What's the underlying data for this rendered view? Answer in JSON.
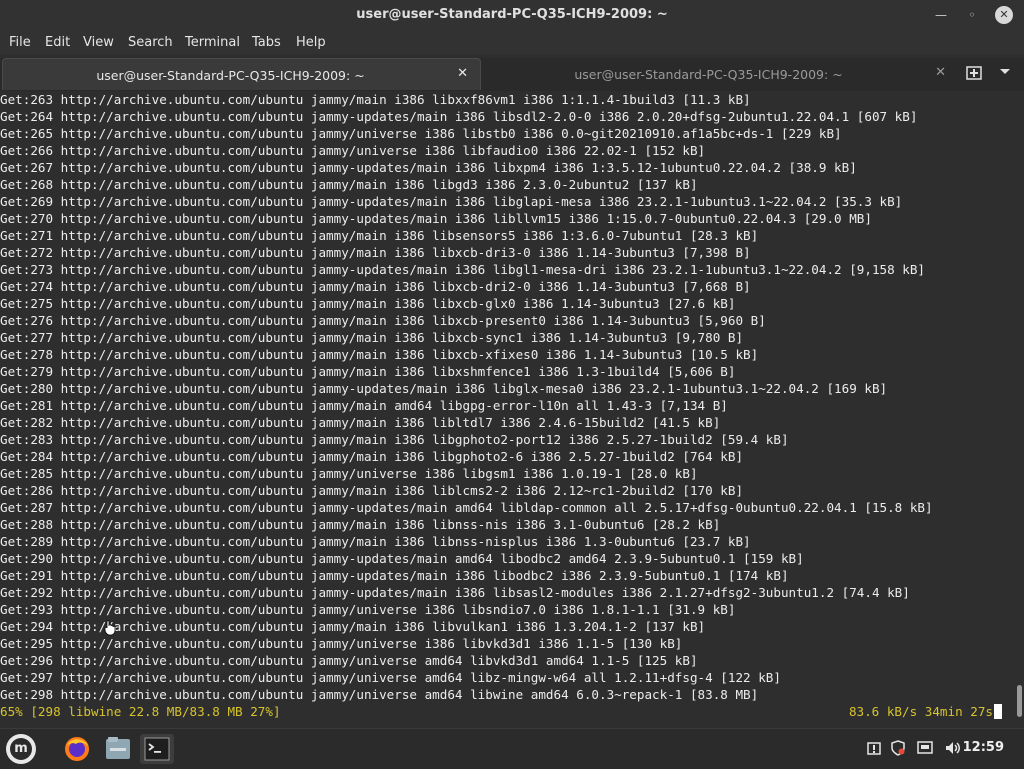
{
  "window": {
    "title": "user@user-Standard-PC-Q35-ICH9-2009: ~",
    "controls": {
      "minimize": "minimize-icon",
      "maximize": "maximize-icon",
      "close": "close-icon"
    }
  },
  "menu": [
    "File",
    "Edit",
    "View",
    "Search",
    "Terminal",
    "Tabs",
    "Help"
  ],
  "tabs": [
    {
      "label": "user@user-Standard-PC-Q35-ICH9-2009: ~",
      "active": true
    },
    {
      "label": "user@user-Standard-PC-Q35-ICH9-2009: ~",
      "active": false
    }
  ],
  "tab_close_symbol": "✕",
  "terminal": {
    "lines": [
      "Get:263 http://archive.ubuntu.com/ubuntu jammy/main i386 libxxf86vm1 i386 1:1.1.4-1build3 [11.3 kB]",
      "Get:264 http://archive.ubuntu.com/ubuntu jammy-updates/main i386 libsdl2-2.0-0 i386 2.0.20+dfsg-2ubuntu1.22.04.1 [607 kB]",
      "Get:265 http://archive.ubuntu.com/ubuntu jammy/universe i386 libstb0 i386 0.0~git20210910.af1a5bc+ds-1 [229 kB]",
      "Get:266 http://archive.ubuntu.com/ubuntu jammy/universe i386 libfaudio0 i386 22.02-1 [152 kB]",
      "Get:267 http://archive.ubuntu.com/ubuntu jammy-updates/main i386 libxpm4 i386 1:3.5.12-1ubuntu0.22.04.2 [38.9 kB]",
      "Get:268 http://archive.ubuntu.com/ubuntu jammy/main i386 libgd3 i386 2.3.0-2ubuntu2 [137 kB]",
      "Get:269 http://archive.ubuntu.com/ubuntu jammy-updates/main i386 libglapi-mesa i386 23.2.1-1ubuntu3.1~22.04.2 [35.3 kB]",
      "Get:270 http://archive.ubuntu.com/ubuntu jammy-updates/main i386 libllvm15 i386 1:15.0.7-0ubuntu0.22.04.3 [29.0 MB]",
      "Get:271 http://archive.ubuntu.com/ubuntu jammy/main i386 libsensors5 i386 1:3.6.0-7ubuntu1 [28.3 kB]",
      "Get:272 http://archive.ubuntu.com/ubuntu jammy/main i386 libxcb-dri3-0 i386 1.14-3ubuntu3 [7,398 B]",
      "Get:273 http://archive.ubuntu.com/ubuntu jammy-updates/main i386 libgl1-mesa-dri i386 23.2.1-1ubuntu3.1~22.04.2 [9,158 kB]",
      "Get:274 http://archive.ubuntu.com/ubuntu jammy/main i386 libxcb-dri2-0 i386 1.14-3ubuntu3 [7,668 B]",
      "Get:275 http://archive.ubuntu.com/ubuntu jammy/main i386 libxcb-glx0 i386 1.14-3ubuntu3 [27.6 kB]",
      "Get:276 http://archive.ubuntu.com/ubuntu jammy/main i386 libxcb-present0 i386 1.14-3ubuntu3 [5,960 B]",
      "Get:277 http://archive.ubuntu.com/ubuntu jammy/main i386 libxcb-sync1 i386 1.14-3ubuntu3 [9,780 B]",
      "Get:278 http://archive.ubuntu.com/ubuntu jammy/main i386 libxcb-xfixes0 i386 1.14-3ubuntu3 [10.5 kB]",
      "Get:279 http://archive.ubuntu.com/ubuntu jammy/main i386 libxshmfence1 i386 1.3-1build4 [5,606 B]",
      "Get:280 http://archive.ubuntu.com/ubuntu jammy-updates/main i386 libglx-mesa0 i386 23.2.1-1ubuntu3.1~22.04.2 [169 kB]",
      "Get:281 http://archive.ubuntu.com/ubuntu jammy/main amd64 libgpg-error-l10n all 1.43-3 [7,134 B]",
      "Get:282 http://archive.ubuntu.com/ubuntu jammy/main i386 libltdl7 i386 2.4.6-15build2 [41.5 kB]",
      "Get:283 http://archive.ubuntu.com/ubuntu jammy/main i386 libgphoto2-port12 i386 2.5.27-1build2 [59.4 kB]",
      "Get:284 http://archive.ubuntu.com/ubuntu jammy/main i386 libgphoto2-6 i386 2.5.27-1build2 [764 kB]",
      "Get:285 http://archive.ubuntu.com/ubuntu jammy/universe i386 libgsm1 i386 1.0.19-1 [28.0 kB]",
      "Get:286 http://archive.ubuntu.com/ubuntu jammy/main i386 liblcms2-2 i386 2.12~rc1-2build2 [170 kB]",
      "Get:287 http://archive.ubuntu.com/ubuntu jammy-updates/main amd64 libldap-common all 2.5.17+dfsg-0ubuntu0.22.04.1 [15.8 kB]",
      "Get:288 http://archive.ubuntu.com/ubuntu jammy/main i386 libnss-nis i386 3.1-0ubuntu6 [28.2 kB]",
      "Get:289 http://archive.ubuntu.com/ubuntu jammy/main i386 libnss-nisplus i386 1.3-0ubuntu6 [23.7 kB]",
      "Get:290 http://archive.ubuntu.com/ubuntu jammy-updates/main amd64 libodbc2 amd64 2.3.9-5ubuntu0.1 [159 kB]",
      "Get:291 http://archive.ubuntu.com/ubuntu jammy-updates/main i386 libodbc2 i386 2.3.9-5ubuntu0.1 [174 kB]",
      "Get:292 http://archive.ubuntu.com/ubuntu jammy-updates/main i386 libsasl2-modules i386 2.1.27+dfsg2-3ubuntu1.2 [74.4 kB]",
      "Get:293 http://archive.ubuntu.com/ubuntu jammy/universe i386 libsndio7.0 i386 1.8.1-1.1 [31.9 kB]",
      "Get:294 http://archive.ubuntu.com/ubuntu jammy/main i386 libvulkan1 i386 1.3.204.1-2 [137 kB]",
      "Get:295 http://archive.ubuntu.com/ubuntu jammy/universe i386 libvkd3d1 i386 1.1-5 [130 kB]",
      "Get:296 http://archive.ubuntu.com/ubuntu jammy/universe amd64 libvkd3d1 amd64 1.1-5 [125 kB]",
      "Get:297 http://archive.ubuntu.com/ubuntu jammy/universe amd64 libz-mingw-w64 all 1.2.11+dfsg-4 [122 kB]",
      "Get:298 http://archive.ubuntu.com/ubuntu jammy/universe amd64 libwine amd64 6.0.3~repack-1 [83.8 MB]"
    ],
    "status_left": "65% [298 libwine 22.8 MB/83.8 MB 27%]",
    "status_right": "83.6 kB/s 34min 27s"
  },
  "taskbar": {
    "menu_logo_glyph": "m",
    "apps": [
      "mint-menu-icon",
      "firefox-icon",
      "files-icon",
      "terminal-icon"
    ],
    "tray": [
      "update-manager-icon",
      "shield-icon",
      "network-icon",
      "volume-icon"
    ],
    "clock": "12:59"
  },
  "colors": {
    "status": "#d6c32e",
    "terminal_bg": "#2e2e2e",
    "text": "#ececec"
  }
}
